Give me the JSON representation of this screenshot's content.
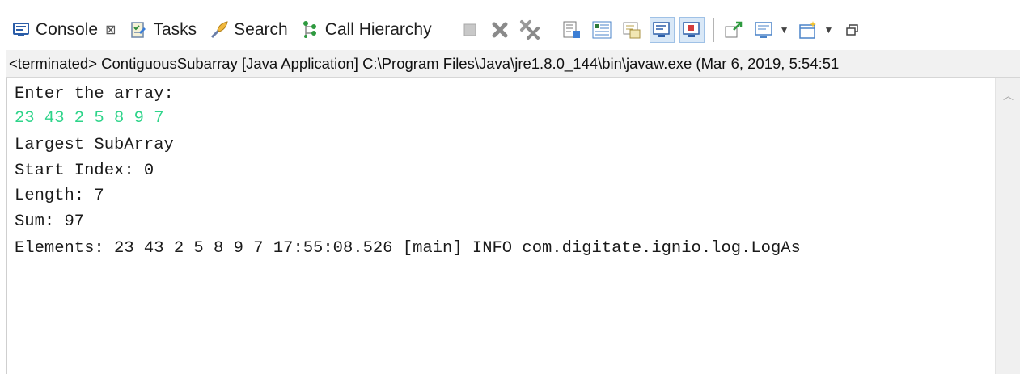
{
  "tabs": [
    {
      "label": "Console",
      "icon": "console-icon",
      "close": "⊠"
    },
    {
      "label": "Tasks",
      "icon": "tasks-icon"
    },
    {
      "label": "Search",
      "icon": "search-icon"
    },
    {
      "label": "Call Hierarchy",
      "icon": "call-hierarchy-icon"
    }
  ],
  "toolbar_icons": [
    "terminate-icon",
    "remove-launch-icon",
    "remove-all-terminated-icon",
    "scroll-lock-icon",
    "word-wrap-icon",
    "show-console-on-output-icon",
    "show-console-on-error-icon",
    "pin-console-icon",
    "display-selected-console-icon",
    "open-console-icon",
    "minimize-icon"
  ],
  "status_text": "<terminated> ContiguousSubarray [Java Application] C:\\Program Files\\Java\\jre1.8.0_144\\bin\\javaw.exe (Mar 6, 2019, 5:54:51",
  "console": {
    "lines": [
      "Enter the array:",
      "23 43 2 5 8 9 7",
      "Largest SubArray",
      "Start Index: 0",
      "Length: 7",
      "Sum: 97",
      "Elements: 23 43 2 5 8 9 7 17:55:08.526 [main] INFO com.digitate.ignio.log.LogAs"
    ]
  },
  "colors": {
    "user_input": "#2ed48a",
    "text": "#1a1a1a"
  }
}
